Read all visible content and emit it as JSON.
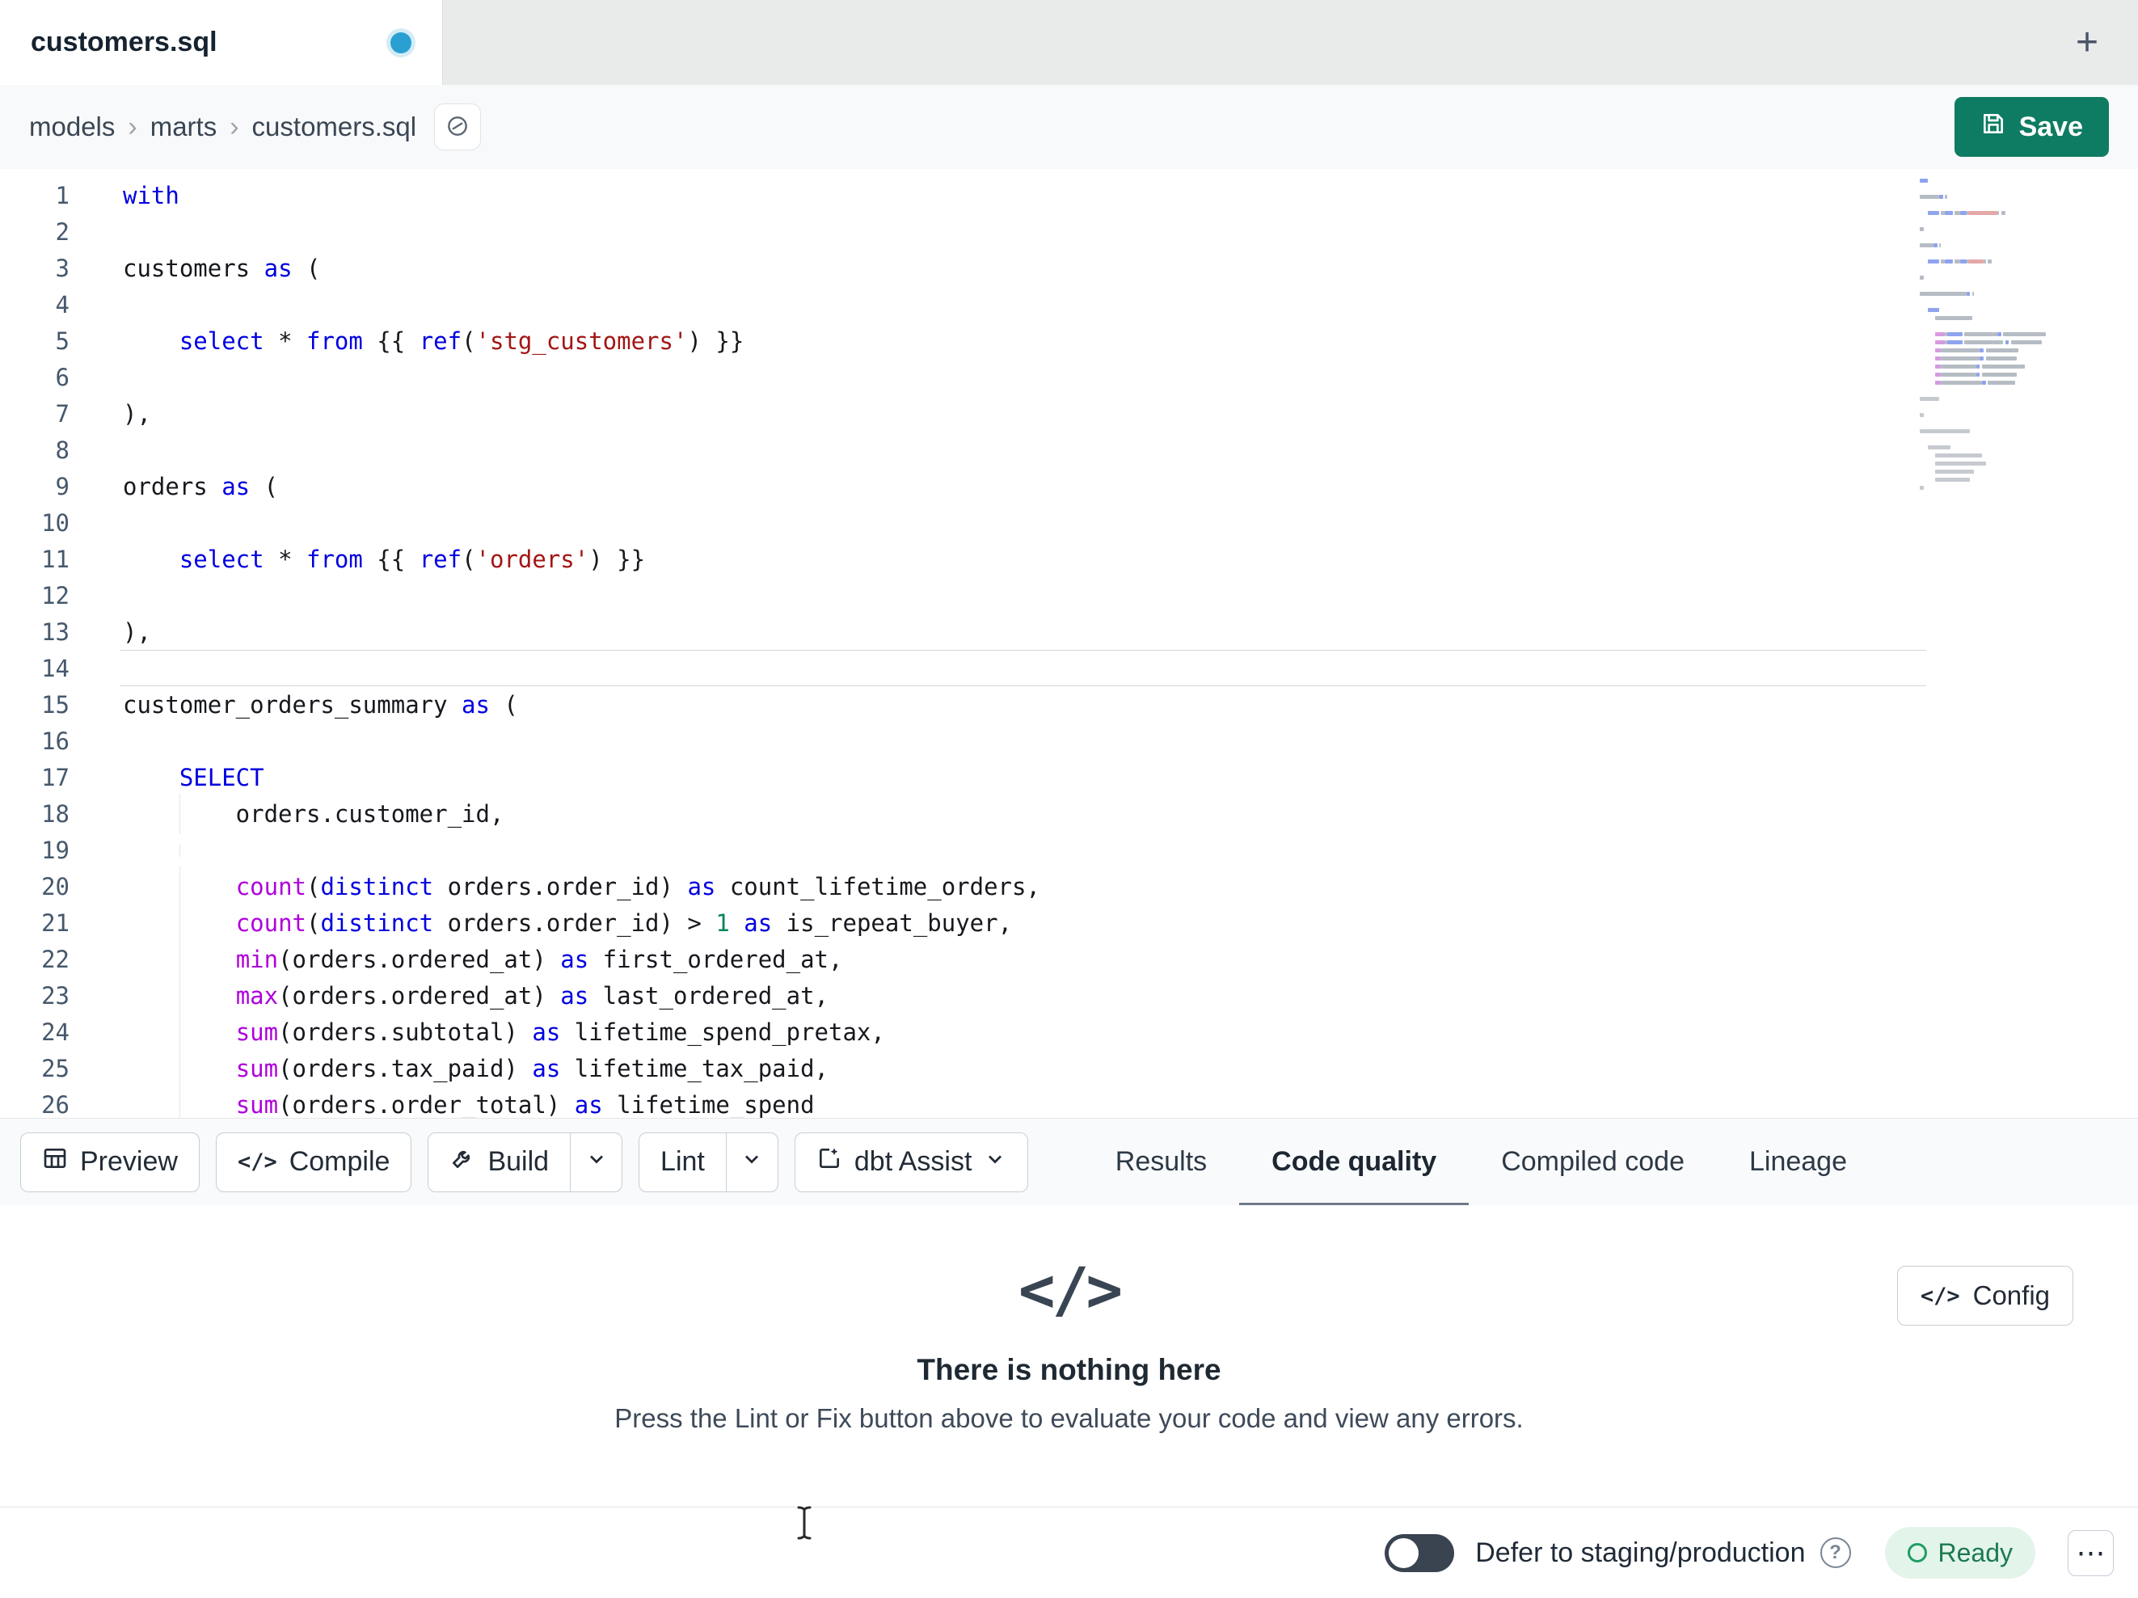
{
  "tab_bar": {
    "active_tab_title": "customers.sql",
    "new_tab_label": "+"
  },
  "breadcrumb": {
    "items": [
      "models",
      "marts",
      "customers.sql"
    ]
  },
  "top_actions": {
    "save_label": "Save"
  },
  "icons": {
    "separator": "›",
    "code": "</>",
    "ellipsis": "⋯",
    "help": "?"
  },
  "colors": {
    "save_button": "#0e7c62",
    "unsaved_dot": "#2aa0d2",
    "ready_bg": "#e3f4eb",
    "ready_text": "#1b7a4e",
    "keyword": "#0000e0",
    "function": "#af00db",
    "string": "#a31515",
    "number": "#098658"
  },
  "editor": {
    "current_line": 14,
    "lines": [
      {
        "num": "1",
        "guide": false,
        "tokens": [
          [
            "with",
            "kw"
          ]
        ]
      },
      {
        "num": "2",
        "guide": false,
        "tokens": []
      },
      {
        "num": "3",
        "guide": false,
        "tokens": [
          [
            "customers ",
            "tx"
          ],
          [
            "as",
            "kw"
          ],
          [
            " (",
            "tx"
          ]
        ]
      },
      {
        "num": "4",
        "guide": false,
        "tokens": []
      },
      {
        "num": "5",
        "guide": false,
        "tokens": [
          [
            "    ",
            "tx"
          ],
          [
            "select",
            "kw"
          ],
          [
            " * ",
            "tx"
          ],
          [
            "from",
            "kw"
          ],
          [
            " {{ ",
            "tx"
          ],
          [
            "ref",
            "kw"
          ],
          [
            "(",
            "tx"
          ],
          [
            "'stg_customers'",
            "st"
          ],
          [
            ")",
            "tx"
          ],
          [
            " }}",
            "tx"
          ]
        ]
      },
      {
        "num": "6",
        "guide": false,
        "tokens": []
      },
      {
        "num": "7",
        "guide": false,
        "tokens": [
          [
            "),",
            "tx"
          ]
        ]
      },
      {
        "num": "8",
        "guide": false,
        "tokens": []
      },
      {
        "num": "9",
        "guide": false,
        "tokens": [
          [
            "orders ",
            "tx"
          ],
          [
            "as",
            "kw"
          ],
          [
            " (",
            "tx"
          ]
        ]
      },
      {
        "num": "10",
        "guide": false,
        "tokens": []
      },
      {
        "num": "11",
        "guide": false,
        "tokens": [
          [
            "    ",
            "tx"
          ],
          [
            "select",
            "kw"
          ],
          [
            " * ",
            "tx"
          ],
          [
            "from",
            "kw"
          ],
          [
            " {{ ",
            "tx"
          ],
          [
            "ref",
            "kw"
          ],
          [
            "(",
            "tx"
          ],
          [
            "'orders'",
            "st"
          ],
          [
            ")",
            "tx"
          ],
          [
            " }}",
            "tx"
          ]
        ]
      },
      {
        "num": "12",
        "guide": false,
        "tokens": []
      },
      {
        "num": "13",
        "guide": false,
        "tokens": [
          [
            "),",
            "tx"
          ]
        ]
      },
      {
        "num": "14",
        "guide": false,
        "tokens": []
      },
      {
        "num": "15",
        "guide": false,
        "tokens": [
          [
            "customer_orders_summary ",
            "tx"
          ],
          [
            "as",
            "kw"
          ],
          [
            " (",
            "tx"
          ]
        ]
      },
      {
        "num": "16",
        "guide": false,
        "tokens": []
      },
      {
        "num": "17",
        "guide": false,
        "tokens": [
          [
            "    ",
            "tx"
          ],
          [
            "SELECT",
            "kw"
          ]
        ]
      },
      {
        "num": "18",
        "guide": true,
        "tokens": [
          [
            "        orders.customer_id,",
            "tx"
          ]
        ]
      },
      {
        "num": "19",
        "guide": true,
        "tokens": []
      },
      {
        "num": "20",
        "guide": true,
        "tokens": [
          [
            "        ",
            "tx"
          ],
          [
            "count",
            "fn"
          ],
          [
            "(",
            "tx"
          ],
          [
            "distinct",
            "kw"
          ],
          [
            " orders.order_id",
            "tx"
          ],
          [
            ") ",
            "tx"
          ],
          [
            "as",
            "kw"
          ],
          [
            " count_lifetime_orders,",
            "tx"
          ]
        ]
      },
      {
        "num": "21",
        "guide": true,
        "tokens": [
          [
            "        ",
            "tx"
          ],
          [
            "count",
            "fn"
          ],
          [
            "(",
            "tx"
          ],
          [
            "distinct",
            "kw"
          ],
          [
            " orders.order_id",
            "tx"
          ],
          [
            ") > ",
            "tx"
          ],
          [
            "1",
            "nu"
          ],
          [
            " ",
            "tx"
          ],
          [
            "as",
            "kw"
          ],
          [
            " is_repeat_buyer,",
            "tx"
          ]
        ]
      },
      {
        "num": "22",
        "guide": true,
        "tokens": [
          [
            "        ",
            "tx"
          ],
          [
            "min",
            "fn"
          ],
          [
            "(orders.ordered_at) ",
            "tx"
          ],
          [
            "as",
            "kw"
          ],
          [
            " first_ordered_at,",
            "tx"
          ]
        ]
      },
      {
        "num": "23",
        "guide": true,
        "tokens": [
          [
            "        ",
            "tx"
          ],
          [
            "max",
            "fn"
          ],
          [
            "(orders.ordered_at) ",
            "tx"
          ],
          [
            "as",
            "kw"
          ],
          [
            " last_ordered_at,",
            "tx"
          ]
        ]
      },
      {
        "num": "24",
        "guide": true,
        "tokens": [
          [
            "        ",
            "tx"
          ],
          [
            "sum",
            "fn"
          ],
          [
            "(orders.subtotal) ",
            "tx"
          ],
          [
            "as",
            "kw"
          ],
          [
            " lifetime_spend_pretax,",
            "tx"
          ]
        ]
      },
      {
        "num": "25",
        "guide": true,
        "tokens": [
          [
            "        ",
            "tx"
          ],
          [
            "sum",
            "fn"
          ],
          [
            "(orders.tax_paid) ",
            "tx"
          ],
          [
            "as",
            "kw"
          ],
          [
            " lifetime_tax_paid,",
            "tx"
          ]
        ]
      },
      {
        "num": "26",
        "guide": true,
        "tokens": [
          [
            "        ",
            "tx"
          ],
          [
            "sum",
            "fn"
          ],
          [
            "(orders.order_total) ",
            "tx"
          ],
          [
            "as",
            "kw"
          ],
          [
            " lifetime_spend",
            "tx"
          ]
        ]
      }
    ],
    "minimap_extra": [
      [
        0,
        0
      ],
      [
        0,
        10
      ],
      [
        0,
        0
      ],
      [
        0,
        2
      ],
      [
        0,
        0
      ],
      [
        0,
        26
      ],
      [
        0,
        0
      ],
      [
        4,
        12
      ],
      [
        8,
        24
      ],
      [
        8,
        26
      ],
      [
        8,
        20
      ],
      [
        8,
        18
      ],
      [
        0,
        2
      ],
      [
        0,
        0
      ]
    ]
  },
  "actions": {
    "preview": "Preview",
    "compile": "Compile",
    "build": "Build",
    "lint": "Lint",
    "dbt_assist": "dbt Assist"
  },
  "panel_tabs": [
    {
      "label": "Results",
      "active": false
    },
    {
      "label": "Code quality",
      "active": true
    },
    {
      "label": "Compiled code",
      "active": false
    },
    {
      "label": "Lineage",
      "active": false
    }
  ],
  "empty_state": {
    "title": "There is nothing here",
    "subtitle": "Press the Lint or Fix button above to evaluate your code and view any errors.",
    "config_label": "Config"
  },
  "status_bar": {
    "defer_label": "Defer to staging/production",
    "ready_label": "Ready"
  }
}
